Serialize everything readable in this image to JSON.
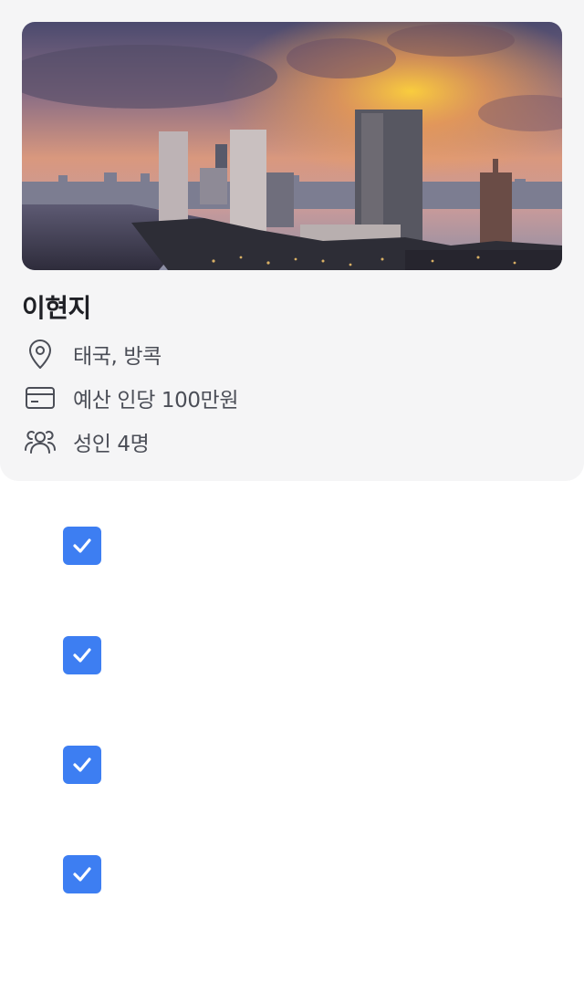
{
  "profile": {
    "name": "이현지",
    "location": "태국, 방콕",
    "budget": "예산 인당 100만원",
    "people": "성인 4명"
  },
  "icons": {
    "location": "map-pin-icon",
    "budget": "credit-card-icon",
    "people": "users-icon",
    "check": "checkmark-icon"
  },
  "checklist": [
    {
      "checked": true
    },
    {
      "checked": true
    },
    {
      "checked": true
    },
    {
      "checked": true
    }
  ],
  "colors": {
    "card_bg": "#f5f5f6",
    "checkbox": "#3d7ef2",
    "name_text": "#1f2025",
    "info_text": "#4b4e57"
  }
}
